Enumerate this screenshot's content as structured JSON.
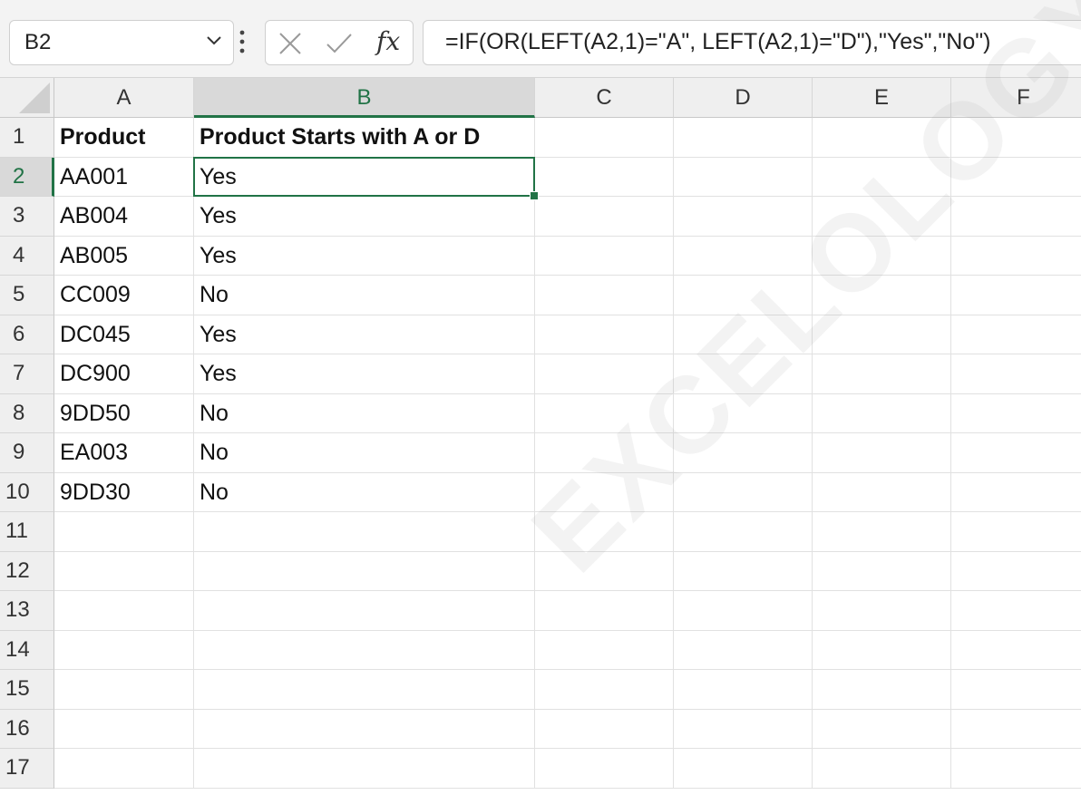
{
  "name_box": {
    "value": "B2"
  },
  "formula_bar": {
    "cancel_icon": "close-icon",
    "enter_icon": "check-icon",
    "fx_label": "fx",
    "formula": "=IF(OR(LEFT(A2,1)=\"A\", LEFT(A2,1)=\"D\"),\"Yes\",\"No\")"
  },
  "columns": [
    "A",
    "B",
    "C",
    "D",
    "E",
    "F"
  ],
  "selected_column": "B",
  "selected_row": "2",
  "rows": [
    {
      "num": "1",
      "cells": [
        "Product",
        "Product Starts with A or D",
        "",
        "",
        "",
        ""
      ]
    },
    {
      "num": "2",
      "cells": [
        "AA001",
        "Yes",
        "",
        "",
        "",
        ""
      ]
    },
    {
      "num": "3",
      "cells": [
        "AB004",
        "Yes",
        "",
        "",
        "",
        ""
      ]
    },
    {
      "num": "4",
      "cells": [
        "AB005",
        "Yes",
        "",
        "",
        "",
        ""
      ]
    },
    {
      "num": "5",
      "cells": [
        "CC009",
        "No",
        "",
        "",
        "",
        ""
      ]
    },
    {
      "num": "6",
      "cells": [
        "DC045",
        "Yes",
        "",
        "",
        "",
        ""
      ]
    },
    {
      "num": "7",
      "cells": [
        "DC900",
        "Yes",
        "",
        "",
        "",
        ""
      ]
    },
    {
      "num": "8",
      "cells": [
        "9DD50",
        "No",
        "",
        "",
        "",
        ""
      ]
    },
    {
      "num": "9",
      "cells": [
        "EA003",
        "No",
        "",
        "",
        "",
        ""
      ]
    },
    {
      "num": "10",
      "cells": [
        "9DD30",
        "No",
        "",
        "",
        "",
        ""
      ]
    },
    {
      "num": "11",
      "cells": [
        "",
        "",
        "",
        "",
        "",
        ""
      ]
    },
    {
      "num": "12",
      "cells": [
        "",
        "",
        "",
        "",
        "",
        ""
      ]
    },
    {
      "num": "13",
      "cells": [
        "",
        "",
        "",
        "",
        "",
        ""
      ]
    },
    {
      "num": "14",
      "cells": [
        "",
        "",
        "",
        "",
        "",
        ""
      ]
    },
    {
      "num": "15",
      "cells": [
        "",
        "",
        "",
        "",
        "",
        ""
      ]
    },
    {
      "num": "16",
      "cells": [
        "",
        "",
        "",
        "",
        "",
        ""
      ]
    },
    {
      "num": "17",
      "cells": [
        "",
        "",
        "",
        "",
        "",
        ""
      ]
    }
  ],
  "watermark": "EXCELOLOGY.COM",
  "colors": {
    "accent": "#217346",
    "header_bg": "#efefef",
    "selected_header_bg": "#d9d9d9"
  }
}
